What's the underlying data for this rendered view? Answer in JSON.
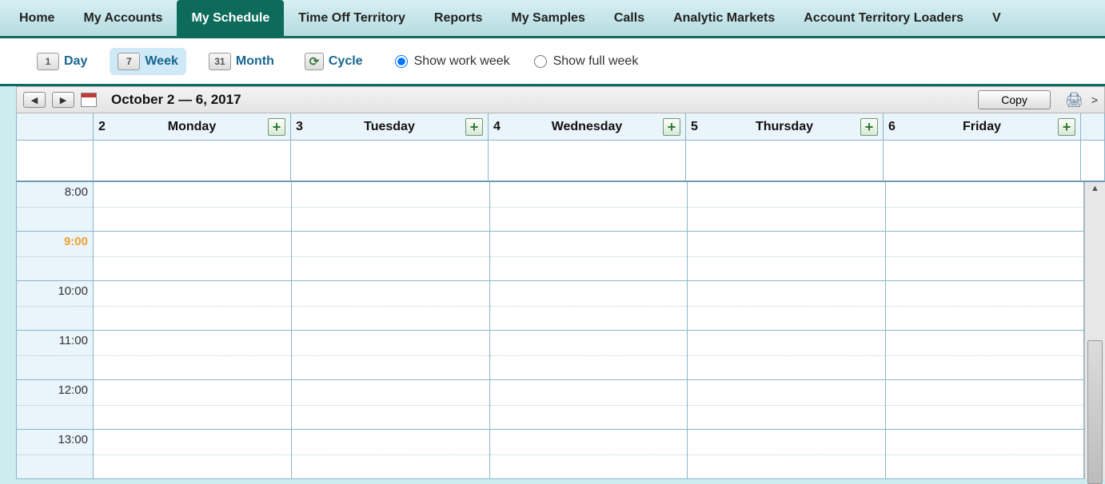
{
  "nav": {
    "tabs": [
      "Home",
      "My Accounts",
      "My Schedule",
      "Time Off Territory",
      "Reports",
      "My Samples",
      "Calls",
      "Analytic Markets",
      "Account Territory Loaders",
      "V"
    ],
    "active_index": 2
  },
  "views": {
    "day": {
      "num": "1",
      "label": "Day"
    },
    "week": {
      "num": "7",
      "label": "Week"
    },
    "month": {
      "num": "31",
      "label": "Month"
    },
    "cycle": {
      "icon": "⟳",
      "label": "Cycle"
    }
  },
  "week_filter": {
    "work_label": "Show work week",
    "full_label": "Show full week",
    "selected": "work"
  },
  "toolbar": {
    "date_range": "October 2 — 6, 2017",
    "copy_label": "Copy"
  },
  "days": [
    {
      "num": "2",
      "name": "Monday"
    },
    {
      "num": "3",
      "name": "Tuesday"
    },
    {
      "num": "4",
      "name": "Wednesday"
    },
    {
      "num": "5",
      "name": "Thursday"
    },
    {
      "num": "6",
      "name": "Friday"
    }
  ],
  "hours": [
    "8:00",
    "9:00",
    "10:00",
    "11:00",
    "12:00",
    "13:00"
  ],
  "current_hour_index": 1
}
